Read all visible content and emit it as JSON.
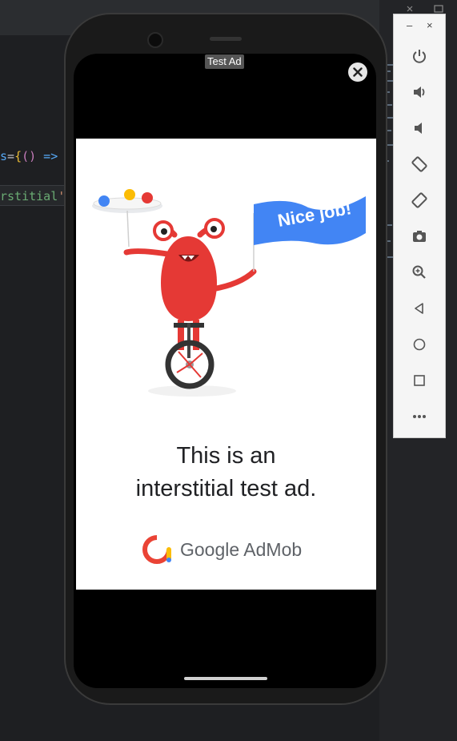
{
  "editor": {
    "line1": {
      "prefix": "s",
      "op": "=",
      "open": "{",
      "parens": "()",
      "arrow": " =>"
    },
    "line2": {
      "text": "rstitial",
      "quote": "'"
    }
  },
  "ad": {
    "label": "Test Ad",
    "banner_text": "Nice job!",
    "headline_line1": "This is an",
    "headline_line2": "interstitial test ad.",
    "brand": "Google AdMob"
  },
  "emulator": {
    "minimize_label": "–",
    "close_label": "×",
    "controls": [
      "power-icon",
      "volume-up-icon",
      "volume-down-icon",
      "rotate-left-icon",
      "rotate-right-icon",
      "camera-icon",
      "zoom-icon",
      "back-icon",
      "home-icon",
      "overview-icon",
      "more-icon"
    ]
  },
  "colors": {
    "monster_red": "#e53935",
    "flag_blue": "#4285f4",
    "admob_red": "#ea4335",
    "admob_yellow": "#fbbc04",
    "admob_blue": "#4285f4"
  }
}
